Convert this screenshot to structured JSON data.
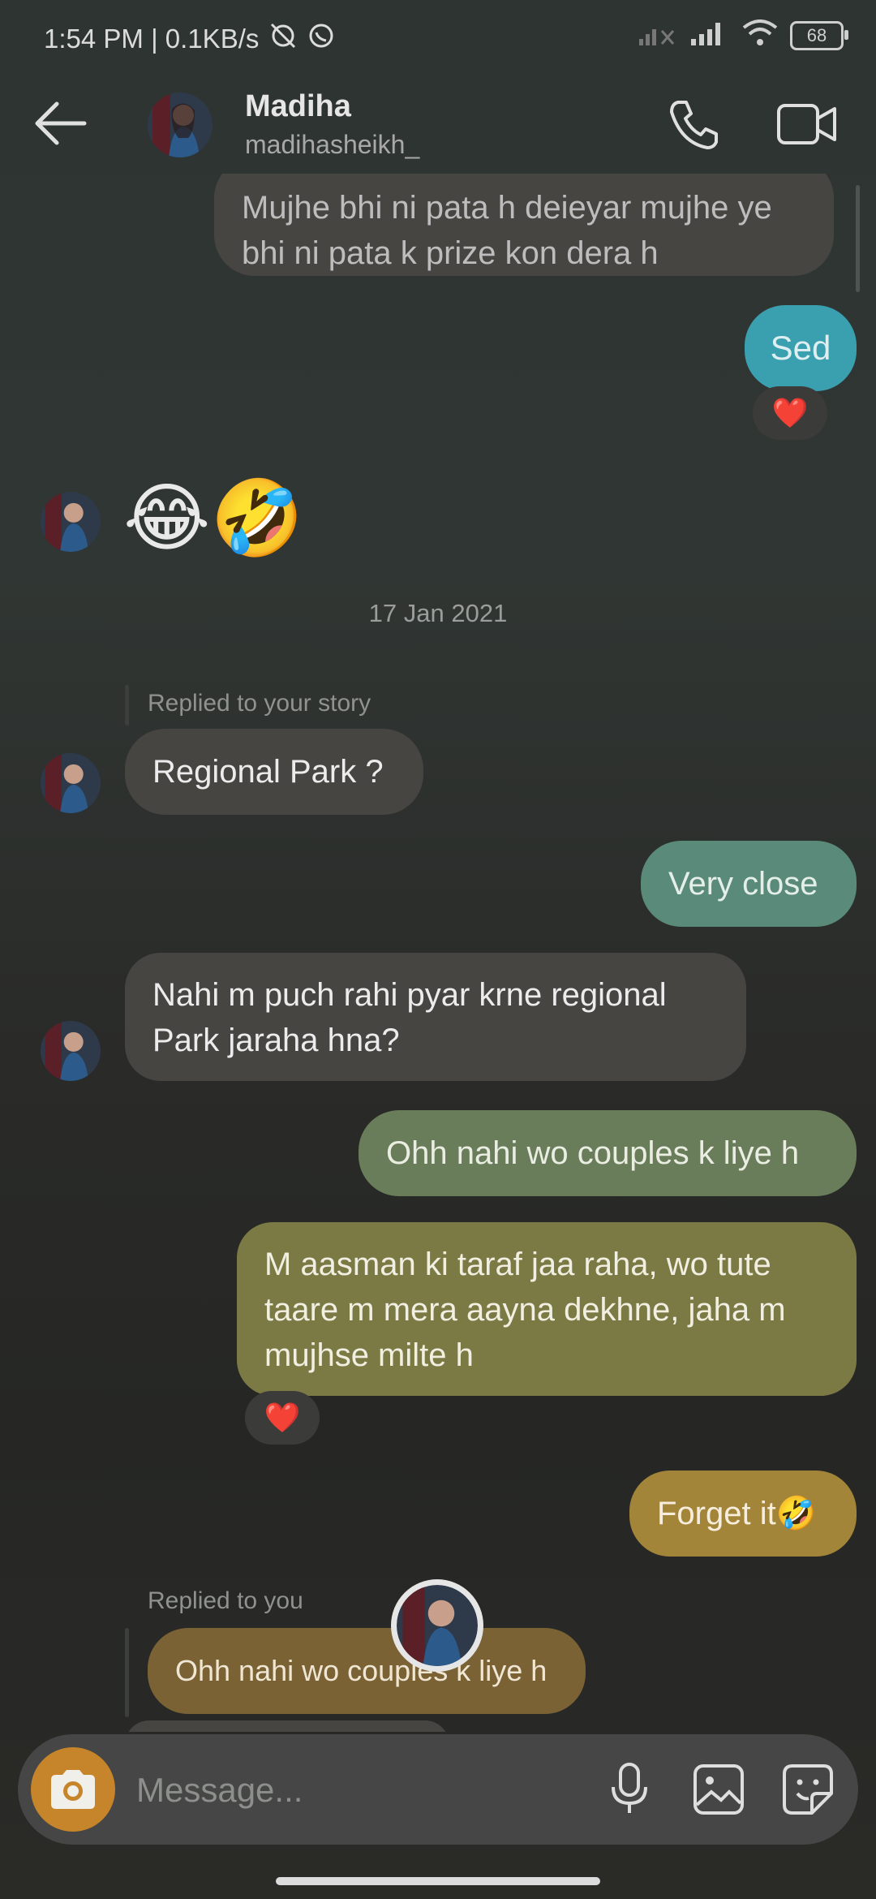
{
  "status": {
    "time_speed": "1:54 PM | 0.1KB/s",
    "battery": "68"
  },
  "header": {
    "name": "Madiha",
    "username": "madihasheikh_"
  },
  "messages": {
    "m1": "Mujhe bhi ni pata h deieyar mujhe ye bhi ni pata k prize kon dera h",
    "m2": "Sed",
    "m3": "😂🤣",
    "date": "17 Jan 2021",
    "reply1_label": "Replied to your story",
    "m4": "Regional Park ?",
    "m5": "Very close",
    "m6": "Nahi m puch rahi pyar krne regional Park jaraha hna?",
    "m7": "Ohh nahi wo couples k liye h",
    "m8": "M aasman ki taraf jaa raha, wo tute taare m mera aayna dekhne, jaha m mujhse milte h",
    "m9": "Forget it🤣",
    "reply2_label": "Replied to you",
    "m10": "Ohh nahi wo couples k liye h"
  },
  "reactions": {
    "r1": "❤️",
    "r2": "❤️"
  },
  "composer": {
    "placeholder": "Message..."
  },
  "colors": {
    "bubble_in": "#474542",
    "bubble_out_1": "#3a9fae",
    "bubble_out_2": "#5a8a7a",
    "bubble_out_3": "#6a7d5a",
    "bubble_out_4": "#7c7a44",
    "bubble_out_5": "#a3853a",
    "camera_button": "#c6852b"
  },
  "icons": [
    "back-arrow-icon",
    "phone-icon",
    "video-camera-icon",
    "camera-icon",
    "microphone-icon",
    "image-icon",
    "sticker-icon",
    "heart-icon"
  ]
}
